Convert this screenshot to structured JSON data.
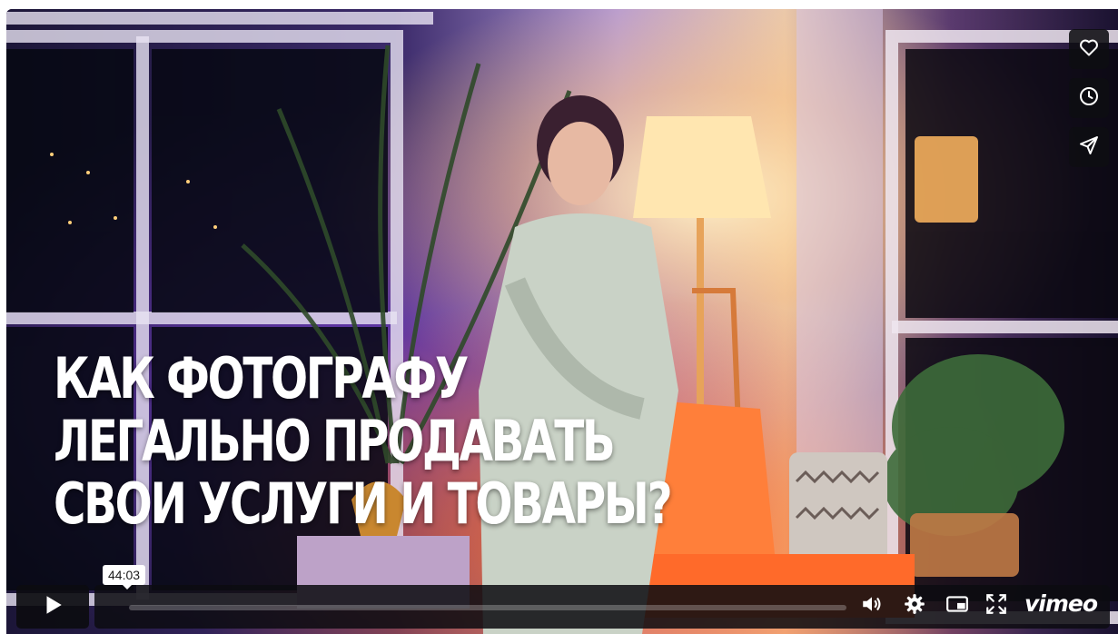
{
  "video": {
    "title_lines": [
      "КАК ФОТОГРАФУ",
      "ЛЕГАЛЬНО ПРОДАВАТЬ",
      "СВОИ УСЛУГИ И ТОВАРЫ?"
    ]
  },
  "side_actions": [
    {
      "name": "like",
      "icon": "heart-icon"
    },
    {
      "name": "watch-later",
      "icon": "clock-icon"
    },
    {
      "name": "share",
      "icon": "send-icon"
    }
  ],
  "controls": {
    "time_tooltip": "44:03",
    "progress_fraction": 0,
    "brand": "vimeo",
    "icons": [
      "play-icon",
      "volume-icon",
      "settings-icon",
      "picture-in-picture-icon",
      "fullscreen-icon"
    ]
  },
  "colors": {
    "overlay_bg": "#0e0e12",
    "title_text": "#ffffff",
    "accent_lamp": "#ffb35a",
    "ambient_purple": "#6a3fb8",
    "ambient_orange": "#ff6a2a"
  }
}
